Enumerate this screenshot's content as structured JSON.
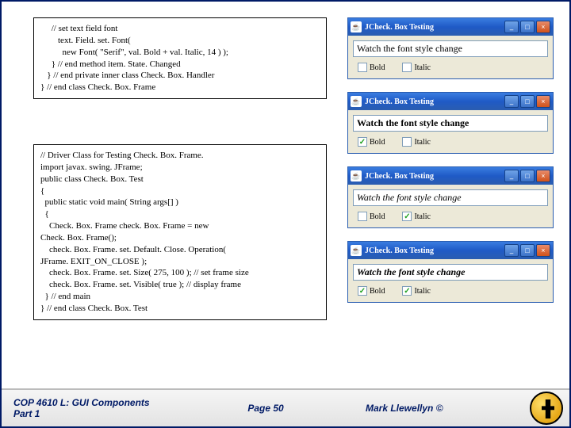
{
  "code1": {
    "l0": "     // set text field font",
    "l1": "        text. Field. set. Font(",
    "l2": "          new Font( \"Serif\", val. Bold + val. Italic, 14 ) );",
    "l3": "     } // end method item. State. Changed",
    "l4": "   } // end private inner class Check. Box. Handler",
    "l5": "} // end class Check. Box. Frame"
  },
  "code2": {
    "l0": "// Driver Class for Testing Check. Box. Frame.",
    "l1": "import javax. swing. JFrame;",
    "l2": "",
    "l3": "public class Check. Box. Test",
    "l4": "{",
    "l5": "  public static void main( String args[] )",
    "l6": "  {",
    "l7": "    Check. Box. Frame check. Box. Frame = new",
    "l8": "Check. Box. Frame();",
    "l9": "    check. Box. Frame. set. Default. Close. Operation(",
    "l10": "JFrame. EXIT_ON_CLOSE );",
    "l11": "    check. Box. Frame. set. Size( 275, 100 ); // set frame size",
    "l12": "    check. Box. Frame. set. Visible( true ); // display frame",
    "l13": "  } // end main",
    "l14": "} // end class Check. Box. Test"
  },
  "win": {
    "title": "JCheck. Box Testing",
    "field": "Watch the font style change",
    "boldLabel": "Bold",
    "italicLabel": "Italic",
    "checkMark": "✓",
    "javaGlyph": "☕",
    "minGlyph": "_",
    "maxGlyph": "□",
    "closeGlyph": "×"
  },
  "footer": {
    "left": "COP 4610 L: GUI Components Part 1",
    "center": "Page 50",
    "right": "Mark Llewellyn ©"
  }
}
